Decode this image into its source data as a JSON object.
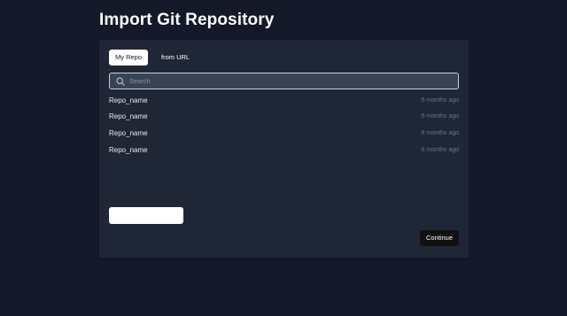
{
  "header": {
    "title": "Import Git Repository"
  },
  "tabs": [
    {
      "label": "My Repo",
      "active": true
    },
    {
      "label": "from URL",
      "active": false
    }
  ],
  "search": {
    "placeholder": "Search",
    "icon": "search-icon"
  },
  "repos": [
    {
      "name": "Repo_name",
      "updated": "6 months ago"
    },
    {
      "name": "Repo_name",
      "updated": "6 months ago"
    },
    {
      "name": "Repo_name",
      "updated": "6 months ago"
    },
    {
      "name": "Repo_name",
      "updated": "6 months ago"
    }
  ],
  "actions": {
    "continue_label": "Continue"
  },
  "colors": {
    "background": "#131929",
    "card": "#1f2737",
    "text": "#ffffff",
    "muted": "#6b7485"
  }
}
